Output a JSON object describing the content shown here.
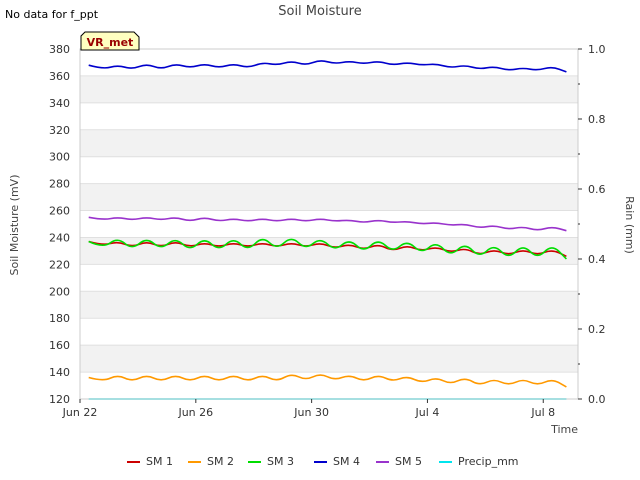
{
  "note": "No data for f_ppt",
  "site_tag": "VR_met",
  "chart_data": {
    "type": "line",
    "title": "Soil Moisture",
    "xlabel": "Time",
    "ylabel": "Soil Moisture (mV)",
    "y2label": "Rain (mm)",
    "xlim": [
      0,
      17.2
    ],
    "ylim": [
      120,
      380
    ],
    "y2lim": [
      0.0,
      1.0
    ],
    "x_ticks": [
      {
        "x": 0,
        "label": "Jun 22"
      },
      {
        "x": 4,
        "label": "Jun 26"
      },
      {
        "x": 8,
        "label": "Jun 30"
      },
      {
        "x": 12,
        "label": "Jul 4"
      },
      {
        "x": 16,
        "label": "Jul 8"
      }
    ],
    "y_ticks": [
      120,
      140,
      160,
      180,
      200,
      220,
      240,
      260,
      280,
      300,
      320,
      340,
      360,
      380
    ],
    "y2_ticks": [
      "0.0",
      "0.2",
      "0.4",
      "0.6",
      "0.8",
      "1.0"
    ],
    "grid": "horizontal bands",
    "legend_position": "bottom",
    "series": [
      {
        "name": "SM 1",
        "color": "#cc0000",
        "axis": "left",
        "x": [
          0.3,
          0.8,
          1.3,
          1.8,
          2.3,
          2.8,
          3.3,
          3.8,
          4.3,
          4.8,
          5.3,
          5.8,
          6.3,
          6.8,
          7.3,
          7.8,
          8.3,
          8.8,
          9.3,
          9.8,
          10.3,
          10.8,
          11.3,
          11.8,
          12.3,
          12.8,
          13.3,
          13.8,
          14.3,
          14.8,
          15.3,
          15.8,
          16.3,
          16.8
        ],
        "y": [
          237,
          234,
          237,
          233,
          237,
          233,
          237,
          233,
          236,
          233,
          236,
          233,
          236,
          233,
          236,
          233,
          236,
          232,
          235,
          231,
          235,
          230,
          234,
          230,
          233,
          229,
          232,
          227,
          231,
          227,
          231,
          227,
          231,
          226
        ]
      },
      {
        "name": "SM 2",
        "color": "#ff9900",
        "axis": "left",
        "x": [
          0.3,
          0.8,
          1.3,
          1.8,
          2.3,
          2.8,
          3.3,
          3.8,
          4.3,
          4.8,
          5.3,
          5.8,
          6.3,
          6.8,
          7.3,
          7.8,
          8.3,
          8.8,
          9.3,
          9.8,
          10.3,
          10.8,
          11.3,
          11.8,
          12.3,
          12.8,
          13.3,
          13.8,
          14.3,
          14.8,
          15.3,
          15.8,
          16.3,
          16.8
        ],
        "y": [
          136,
          133,
          138,
          133,
          138,
          133,
          138,
          133,
          138,
          133,
          138,
          133,
          138,
          133,
          139,
          134,
          139,
          134,
          138,
          133,
          138,
          133,
          137,
          132,
          136,
          131,
          136,
          130,
          135,
          130,
          135,
          130,
          135,
          129
        ]
      },
      {
        "name": "SM 3",
        "color": "#00dd00",
        "axis": "left",
        "x": [
          0.3,
          0.8,
          1.3,
          1.8,
          2.3,
          2.8,
          3.3,
          3.8,
          4.3,
          4.8,
          5.3,
          5.8,
          6.3,
          6.8,
          7.3,
          7.8,
          8.3,
          8.8,
          9.3,
          9.8,
          10.3,
          10.8,
          11.3,
          11.8,
          12.3,
          12.8,
          13.3,
          13.8,
          14.3,
          14.8,
          15.3,
          15.8,
          16.3,
          16.8
        ],
        "y": [
          237,
          232,
          240,
          231,
          240,
          231,
          240,
          230,
          240,
          230,
          240,
          230,
          241,
          231,
          241,
          231,
          240,
          230,
          239,
          229,
          239,
          229,
          238,
          228,
          237,
          226,
          236,
          225,
          235,
          224,
          235,
          224,
          235,
          224
        ]
      },
      {
        "name": "SM 4",
        "color": "#0000cc",
        "axis": "left",
        "x": [
          0.3,
          0.8,
          1.3,
          1.8,
          2.3,
          2.8,
          3.3,
          3.8,
          4.3,
          4.8,
          5.3,
          5.8,
          6.3,
          6.8,
          7.3,
          7.8,
          8.3,
          8.8,
          9.3,
          9.8,
          10.3,
          10.8,
          11.3,
          11.8,
          12.3,
          12.8,
          13.3,
          13.8,
          14.3,
          14.8,
          15.3,
          15.8,
          16.3,
          16.8
        ],
        "y": [
          368,
          365,
          368,
          365,
          369,
          365,
          369,
          366,
          369,
          366,
          369,
          366,
          370,
          368,
          371,
          368,
          372,
          369,
          371,
          369,
          371,
          368,
          370,
          368,
          369,
          366,
          368,
          365,
          367,
          364,
          366,
          364,
          367,
          363
        ]
      },
      {
        "name": "SM 5",
        "color": "#9933cc",
        "axis": "left",
        "x": [
          0.3,
          0.8,
          1.3,
          1.8,
          2.3,
          2.8,
          3.3,
          3.8,
          4.3,
          4.8,
          5.3,
          5.8,
          6.3,
          6.8,
          7.3,
          7.8,
          8.3,
          8.8,
          9.3,
          9.8,
          10.3,
          10.8,
          11.3,
          11.8,
          12.3,
          12.8,
          13.3,
          13.8,
          14.3,
          14.8,
          15.3,
          15.8,
          16.3,
          16.8
        ],
        "y": [
          255,
          253,
          255,
          253,
          255,
          253,
          255,
          252,
          255,
          252,
          254,
          252,
          254,
          252,
          254,
          252,
          254,
          252,
          253,
          251,
          253,
          251,
          252,
          250,
          251,
          249,
          250,
          247,
          249,
          246,
          248,
          245,
          248,
          245
        ]
      },
      {
        "name": "Precip_mm",
        "color": "#00e5ee",
        "axis": "right",
        "x": [
          0.3,
          16.8
        ],
        "y": [
          0.0,
          0.0
        ]
      }
    ]
  }
}
